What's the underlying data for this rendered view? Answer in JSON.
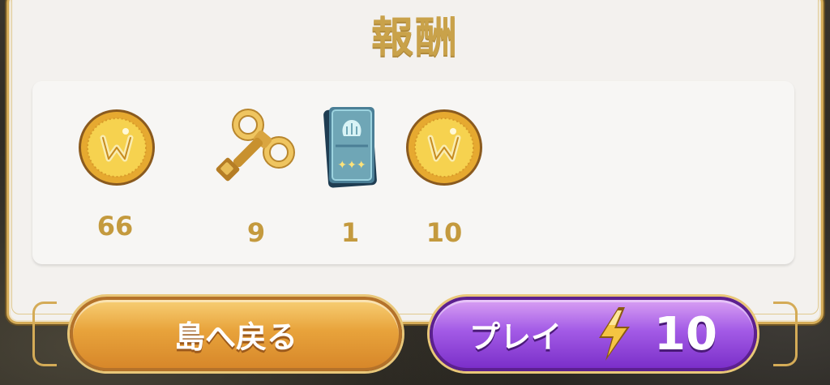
{
  "dialog": {
    "title": "報酬"
  },
  "rewards": [
    {
      "icon": "gold-coin-icon",
      "count": "66"
    },
    {
      "icon": "wind-up-key-icon",
      "count": "9"
    },
    {
      "icon": "card-pack-icon",
      "count": "1"
    },
    {
      "icon": "gold-coin-icon",
      "count": "10"
    }
  ],
  "buttons": {
    "home_label": "島へ戻る",
    "play_label": "プレイ",
    "play_cost": "10",
    "play_cost_icon": "lightning-bolt-icon"
  },
  "colors": {
    "gold_text": "#c49a3e",
    "home_button": "#e8a33b",
    "play_button": "#a35be6",
    "panel": "#f3f1ee"
  }
}
